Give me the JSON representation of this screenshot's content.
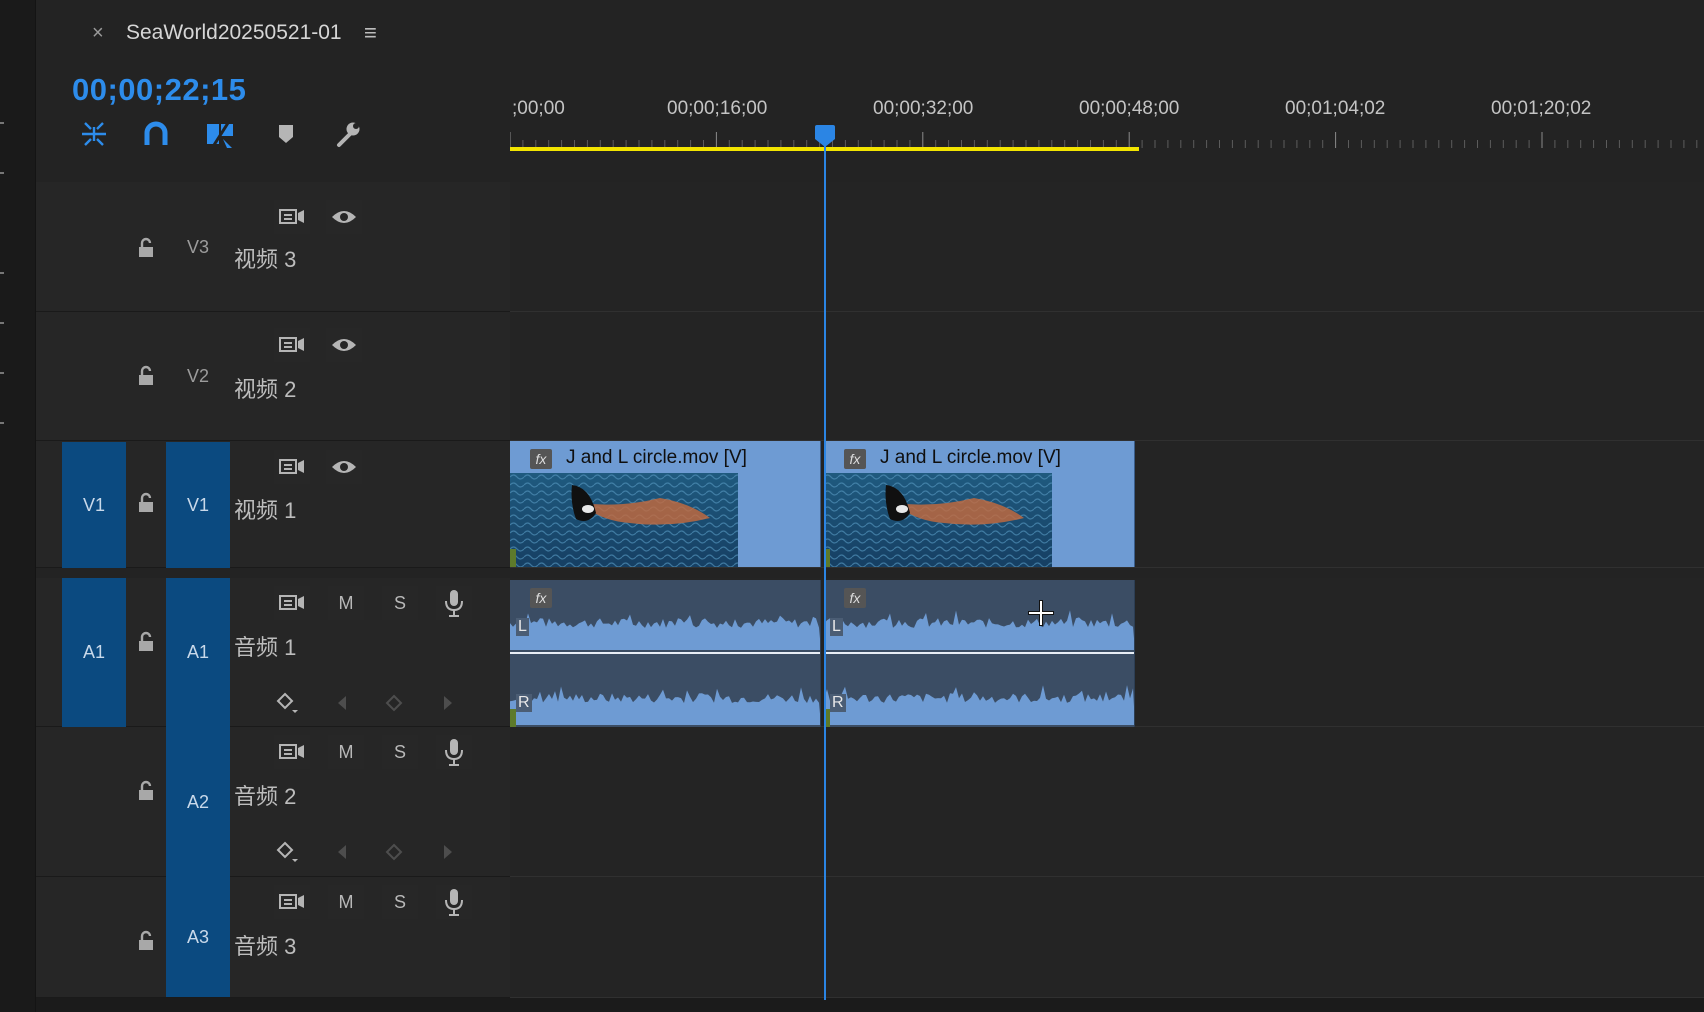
{
  "panel": {
    "close_label": "×",
    "sequence_title": "SeaWorld20250521-01",
    "menu_label": "≡",
    "timecode": "00;00;22;15"
  },
  "toolbar": {
    "icons": [
      "nest-sequence-icon",
      "snap-magnet-icon",
      "linked-selection-icon",
      "add-marker-icon",
      "timeline-settings-wrench-icon"
    ],
    "accent_color": "#2d8ceb"
  },
  "ruler": {
    "labels": [
      ";00;00",
      "00;00;16;00",
      "00;00;32;00",
      "00;00;48;00",
      "00;01;04;02",
      "00;01;20;02"
    ],
    "work_area_color": "#f2e400",
    "playhead_color": "#2b85e4"
  },
  "tracks": {
    "v3": {
      "target": "V3",
      "name": "视频 3"
    },
    "v2": {
      "target": "V2",
      "name": "视频 2"
    },
    "v1": {
      "source": "V1",
      "target": "V1",
      "name": "视频 1"
    },
    "a1": {
      "source": "A1",
      "target": "A1",
      "name": "音频 1",
      "mute": "M",
      "solo": "S"
    },
    "a2": {
      "target": "A2",
      "name": "音频 2",
      "mute": "M",
      "solo": "S"
    },
    "a3": {
      "target": "A3",
      "name": "音频 3",
      "mute": "M",
      "solo": "S"
    }
  },
  "clips": {
    "video": [
      {
        "fx": "fx",
        "label": "J and L circle.mov [V]"
      },
      {
        "fx": "fx",
        "label": "J and L circle.mov [V]"
      }
    ],
    "audio": [
      {
        "fx": "fx",
        "left_channel": "L",
        "right_channel": "R"
      },
      {
        "fx": "fx",
        "left_channel": "L",
        "right_channel": "R"
      }
    ],
    "clip_color": "#6e9bd3",
    "target_color": "#0b4a80"
  }
}
